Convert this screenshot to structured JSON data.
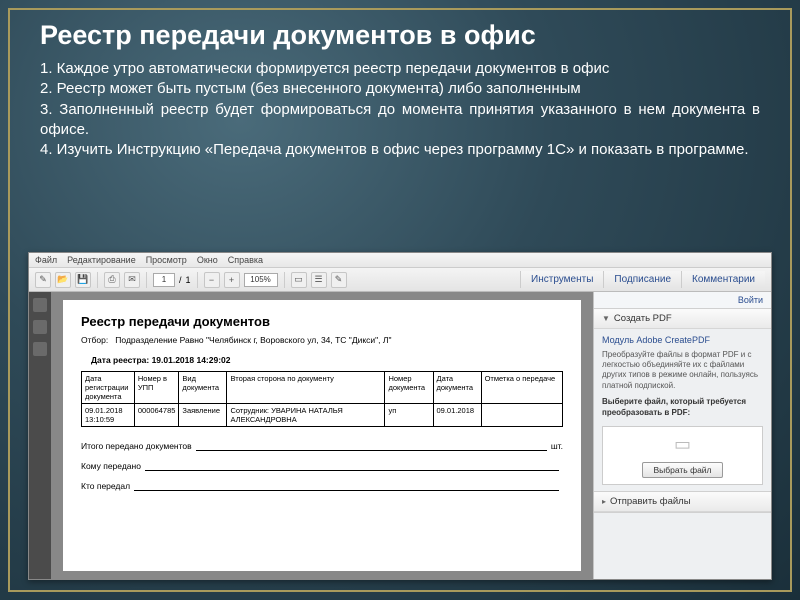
{
  "slide": {
    "title": "Реестр передачи документов в офис",
    "p1": "1. Каждое утро автоматически формируется реестр передачи документов  в офис",
    "p2": "2. Реестр может быть  пустым (без  внесенного документа)  либо заполненным",
    "p3": "3. Заполненный реестр будет формироваться до момента принятия указанного в нем документа в офисе.",
    "p4": "4. Изучить Инструкцию «Передача документов в офис через программу 1С» и показать в программе."
  },
  "menu": {
    "file": "Файл",
    "edit": "Редактирование",
    "view": "Просмотр",
    "window": "Окно",
    "help": "Справка"
  },
  "toolbar": {
    "page_current": "1",
    "page_sep": "/",
    "page_total": "1",
    "zoom": "105%",
    "rtabs": {
      "tools": "Инструменты",
      "sign": "Подписание",
      "comments": "Комментарии"
    }
  },
  "sidepanel": {
    "signin": "Войти",
    "create_head": "Создать PDF",
    "module_title": "Модуль Adobe CreatePDF",
    "module_desc": "Преобразуйте файлы в формат PDF и с легкостью объединяйте их с файлами других типов в режиме онлайн, пользуясь платной подпиской.",
    "choose_label": "Выберите файл, который требуется преобразовать в PDF:",
    "choose_btn": "Выбрать файл",
    "send_head": "Отправить файлы"
  },
  "doc": {
    "title": "Реестр передачи документов",
    "filter_label": "Отбор:",
    "filter_value": "Подразделение Равно \"Челябинск г, Воровского ул, 34, ТС \"Дикси\", Л\"",
    "date_label": "Дата реестра: 19.01.2018 14:29:02",
    "headers": {
      "c1": "Дата регистрации документа",
      "c2": "Номер в УПП",
      "c3": "Вид документа",
      "c4": "Вторая сторона по документу",
      "c5": "Номер документа",
      "c6": "Дата документа",
      "c7": "Отметка о передаче"
    },
    "row": {
      "c1": "09.01.2018 13:10:59",
      "c2": "000064785",
      "c3": "Заявление",
      "c4": "Сотрудник: УВАРИНА НАТАЛЬЯ АЛЕКСАНДРОВНА",
      "c5": "уп",
      "c6": "09.01.2018",
      "c7": ""
    },
    "totals": {
      "line1_a": "Итого передано документов",
      "line1_b": "шт.",
      "line2": "Кому передано",
      "line3": "Кто передал"
    }
  }
}
